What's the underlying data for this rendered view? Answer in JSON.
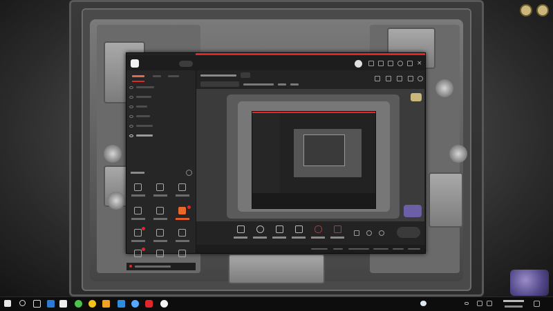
{
  "screen": {
    "width": 800,
    "height": 450
  },
  "hud": {
    "status_text": ""
  },
  "app": {
    "title": "",
    "badge": "",
    "left_tabs": [
      {
        "label": ""
      },
      {
        "label": ""
      },
      {
        "label": ""
      }
    ],
    "active_tab_index": 0,
    "scenes": [
      {
        "label": ""
      },
      {
        "label": ""
      },
      {
        "label": ""
      },
      {
        "label": ""
      },
      {
        "label": ""
      },
      {
        "label": ""
      }
    ],
    "toolbox_title": "",
    "tools": [
      {
        "label": "",
        "icon": "image-icon"
      },
      {
        "label": "",
        "icon": "user-icon"
      },
      {
        "label": "",
        "icon": "document-icon"
      },
      {
        "label": "",
        "icon": "globe-icon"
      },
      {
        "label": "",
        "icon": "download-icon"
      },
      {
        "label": "",
        "icon": "apps-icon"
      },
      {
        "label": "",
        "icon": "users-icon"
      },
      {
        "label": "",
        "icon": "calendar-icon"
      },
      {
        "label": "",
        "icon": "list-icon"
      },
      {
        "label": "",
        "icon": "arrow-icon"
      },
      {
        "label": "",
        "icon": "chart-icon"
      },
      {
        "label": "",
        "icon": "triangle-icon"
      }
    ],
    "highlighted_tool_index": 5,
    "stream_title": "",
    "edit_label": "",
    "category": "",
    "room_id": "",
    "stat_a": "",
    "stat_b": "",
    "controls": [
      {
        "label": "",
        "icon": "monitor-icon"
      },
      {
        "label": "",
        "icon": "camera-icon"
      },
      {
        "label": "",
        "icon": "phone-icon"
      },
      {
        "label": "",
        "icon": "play-icon"
      },
      {
        "label": "",
        "icon": "microphone-icon"
      },
      {
        "label": "",
        "icon": "speaker-icon"
      }
    ],
    "go_live_label": "",
    "status_items": [
      "",
      "",
      "",
      "",
      "",
      "",
      ""
    ]
  },
  "stream_logo": {
    "text_main": "",
    "text_sub": "",
    "room_number": ""
  },
  "taskbar": {
    "apps": [
      "windows-icon",
      "search-icon",
      "taskview-icon",
      "apps-icon",
      "edge-icon",
      "wechat-icon",
      "chrome-icon",
      "folder-icon",
      "mail-icon",
      "store-icon",
      "game-icon",
      "media-icon"
    ],
    "weather": "",
    "weather_desc": "",
    "time": "",
    "date": "",
    "day": ""
  },
  "colors": {
    "accent": "#e4262a",
    "highlight": "#e9682a",
    "panel": "#232323",
    "taskbar": "#0d0d0d"
  }
}
